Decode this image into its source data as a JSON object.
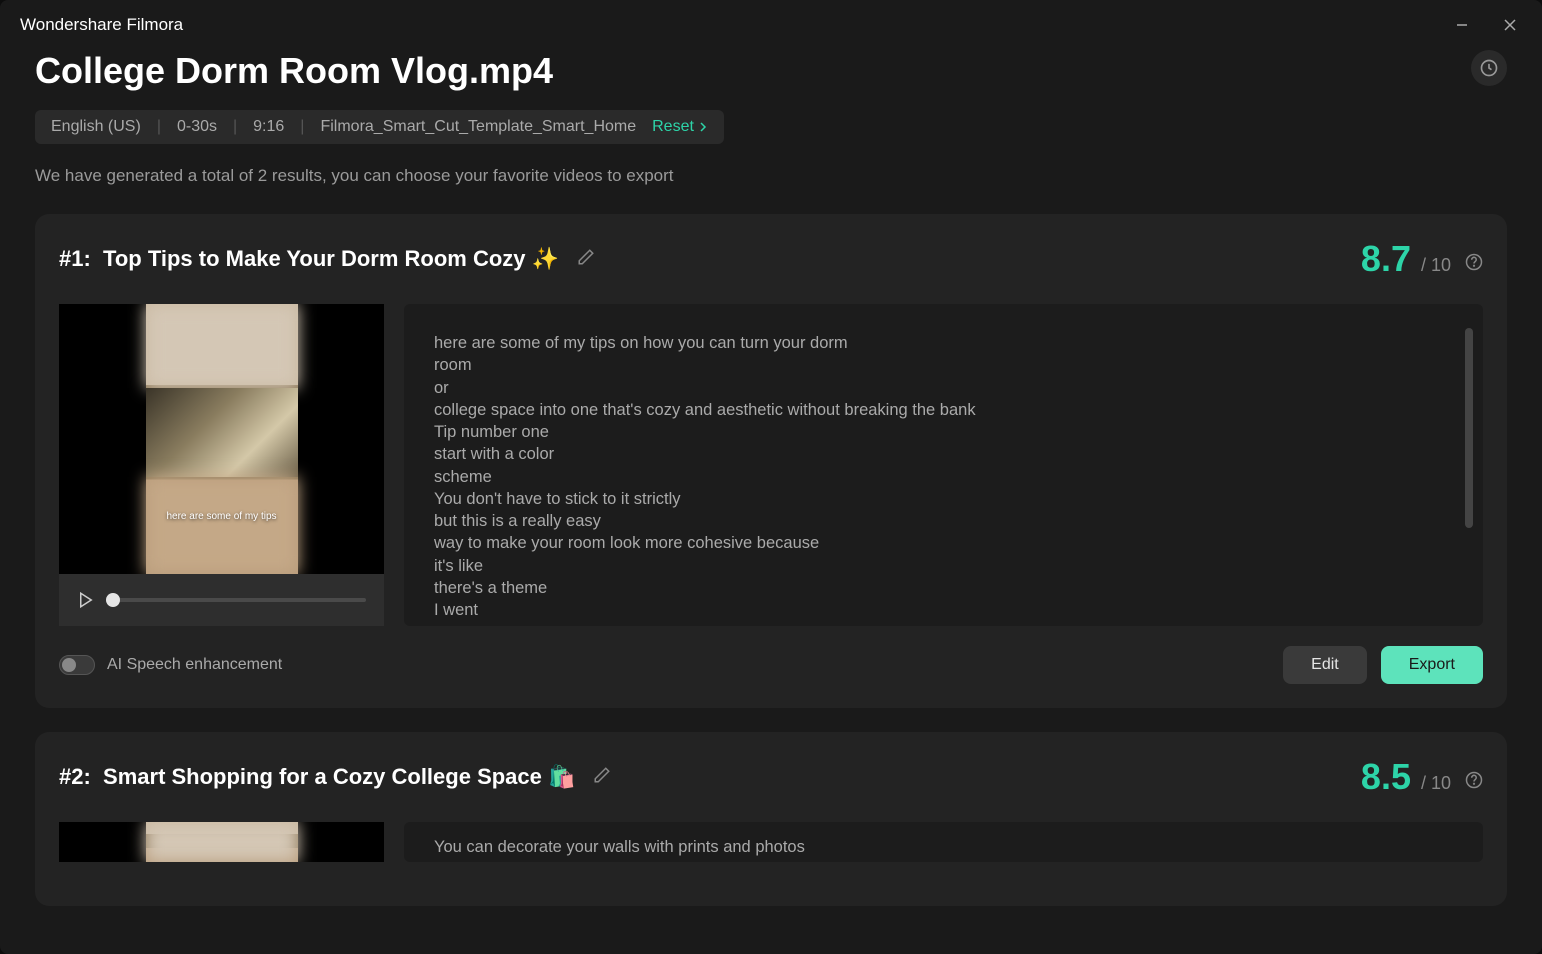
{
  "app": {
    "title": "Wondershare Filmora"
  },
  "page": {
    "title": "College Dorm Room Vlog.mp4",
    "chips": {
      "language": "English (US)",
      "duration": "0-30s",
      "aspect": "9:16",
      "template": "Filmora_Smart_Cut_Template_Smart_Home",
      "reset": "Reset"
    },
    "info": "We have generated a total of 2 results, you can choose your favorite videos to export"
  },
  "results": [
    {
      "index": "#1:",
      "title": "Top Tips to Make Your Dorm Room Cozy ✨",
      "score": "8.7",
      "score_max": "/ 10",
      "thumb_caption": "here are some of my tips",
      "transcript": "here are some of my tips on how you can turn your dorm\nroom\nor\ncollege space into one that's cozy and aesthetic without breaking the bank\nTip number one\nstart with a color\nscheme\nYou don't have to stick to it strictly\nbut this is a really easy\nway to make your room look more cohesive because\nit's like\nthere's a theme\nI went",
      "toggle_label": "AI Speech enhancement",
      "edit_label": "Edit",
      "export_label": "Export"
    },
    {
      "index": "#2:",
      "title": "Smart Shopping for a Cozy College Space 🛍️",
      "score": "8.5",
      "score_max": "/ 10",
      "transcript": "You can decorate your walls with prints and photos"
    }
  ]
}
